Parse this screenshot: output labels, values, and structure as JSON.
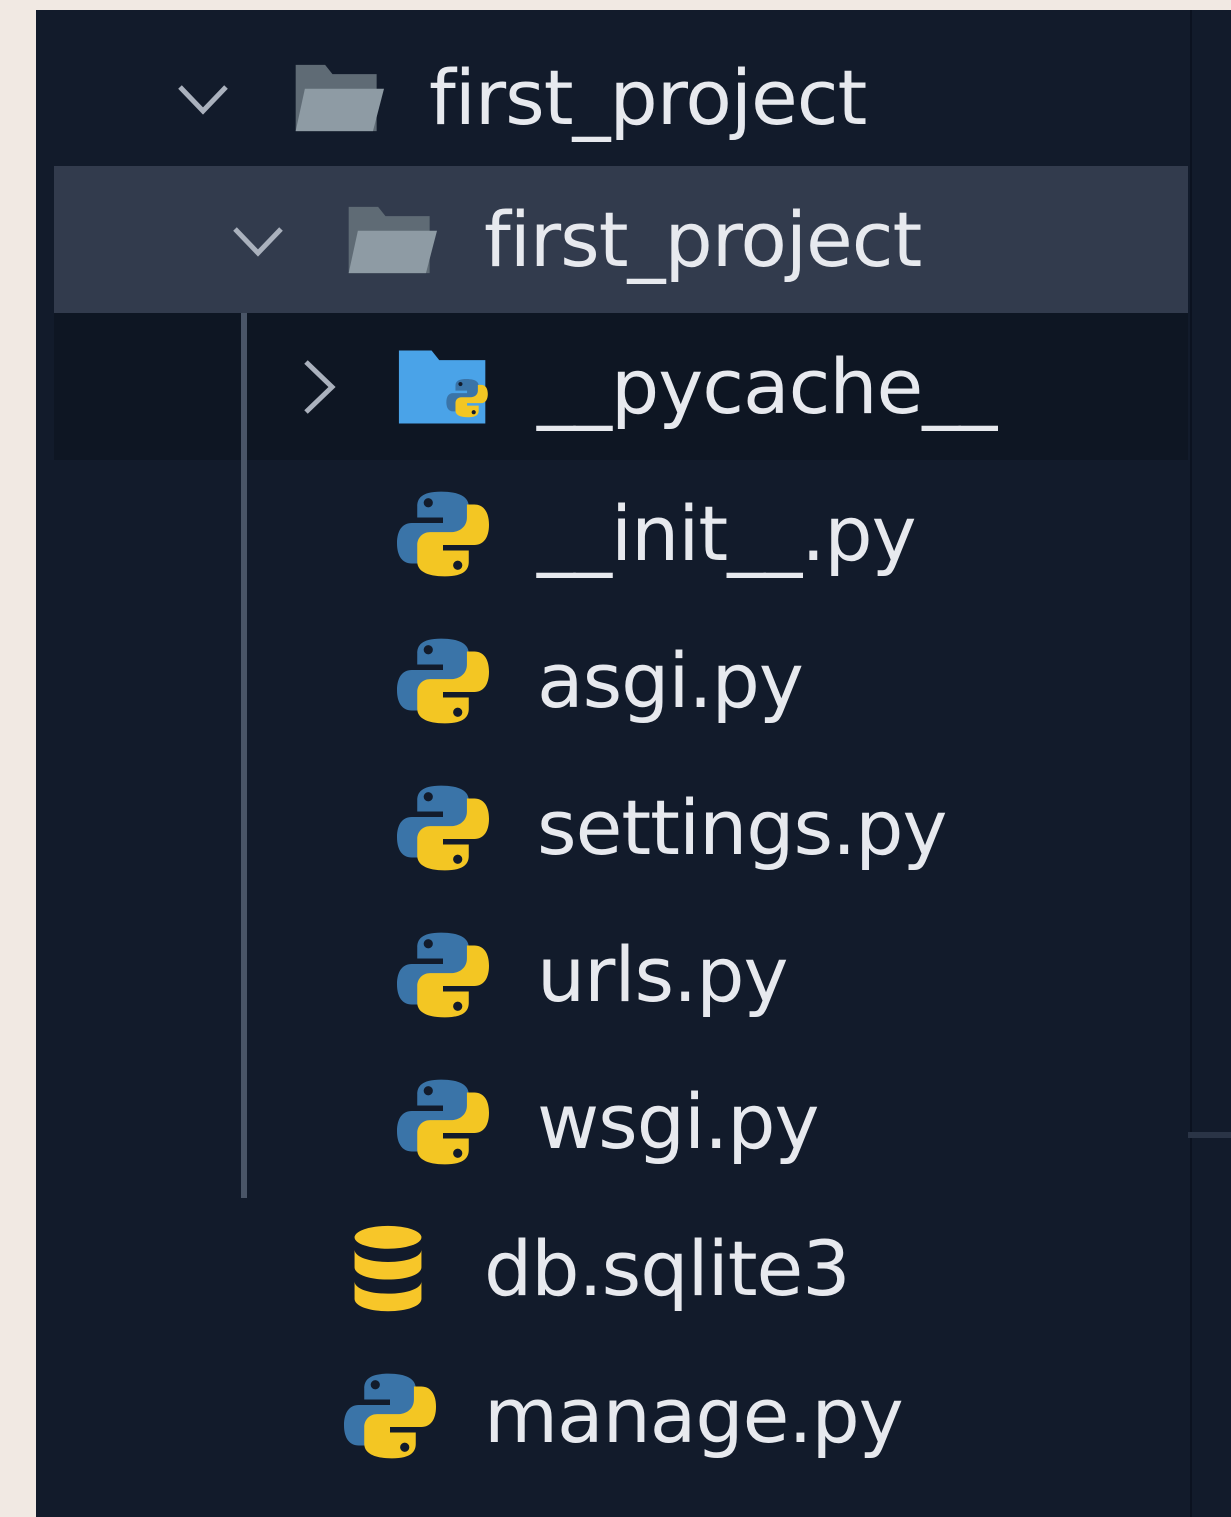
{
  "explorer": {
    "items": [
      {
        "label": "first_project",
        "icon": "folder-open-icon",
        "chevron": "chevron-down-icon"
      },
      {
        "label": "first_project",
        "icon": "folder-open-icon",
        "chevron": "chevron-down-icon"
      },
      {
        "label": "__pycache__",
        "icon": "python-folder-icon",
        "chevron": "chevron-right-icon"
      },
      {
        "label": "__init__.py",
        "icon": "python-icon"
      },
      {
        "label": "asgi.py",
        "icon": "python-icon"
      },
      {
        "label": "settings.py",
        "icon": "python-icon"
      },
      {
        "label": "urls.py",
        "icon": "python-icon"
      },
      {
        "label": "wsgi.py",
        "icon": "python-icon"
      },
      {
        "label": "db.sqlite3",
        "icon": "database-icon"
      },
      {
        "label": "manage.py",
        "icon": "python-icon"
      }
    ]
  },
  "colors": {
    "background": "#121b2b",
    "selected_row": "#323b4d",
    "python_blue": "#3a74a8",
    "python_yellow": "#f3c623",
    "folder_gray": "#8a969f",
    "pycache_folder_blue": "#4aa3e8",
    "database_yellow": "#f7c629"
  }
}
